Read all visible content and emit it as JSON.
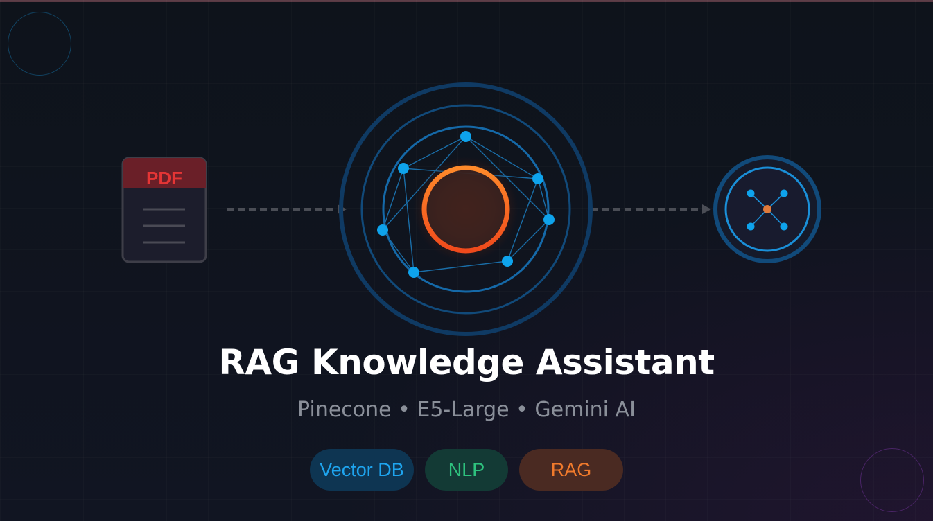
{
  "title": "RAG Knowledge Assistant",
  "subtitle": "Pinecone • E5-Large • Gemini AI",
  "document_icon": {
    "label": "PDF"
  },
  "tags": [
    {
      "label": "Vector DB"
    },
    {
      "label": "NLP"
    },
    {
      "label": "RAG"
    }
  ],
  "colors": {
    "background": "#0f141c",
    "accent_blue": "#1ea4ee",
    "accent_green": "#2ec27e",
    "accent_orange": "#f07a2c",
    "pdf_red": "#e53535",
    "title": "#ffffff",
    "subtitle": "#8a8f99"
  },
  "icons": {
    "document": "pdf-document-icon",
    "network": "vector-network-icon",
    "output": "ai-node-icon"
  }
}
